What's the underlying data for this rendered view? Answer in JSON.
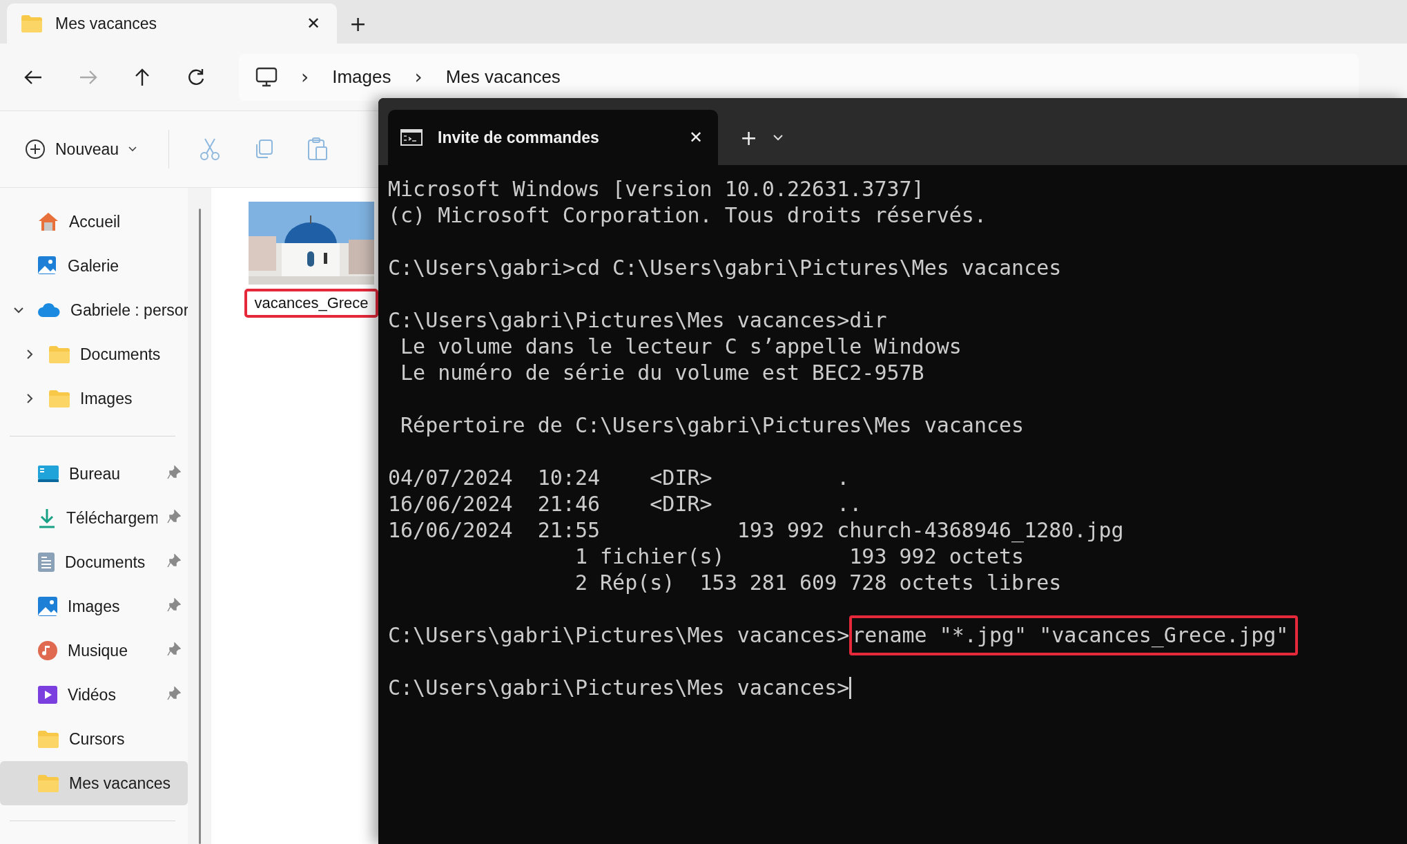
{
  "explorer": {
    "tab": {
      "title": "Mes vacances",
      "close": "✕",
      "new_tab": "+"
    },
    "nav": {
      "forward_disabled": true,
      "breadcrumb": [
        "Images",
        "Mes vacances"
      ],
      "separator": "›"
    },
    "toolbar": {
      "new_label": "Nouveau",
      "clipboard_disabled": true
    },
    "sidebar": {
      "items": [
        {
          "label": "Accueil",
          "selected": false
        },
        {
          "label": "Galerie",
          "selected": false
        },
        {
          "label": "Gabriele : persor",
          "selected": false,
          "expanded": true,
          "children": [
            {
              "label": "Documents",
              "selected": false,
              "expanded": false
            },
            {
              "label": "Images",
              "selected": false,
              "expanded": false
            }
          ]
        }
      ],
      "pinned": [
        {
          "label": "Bureau",
          "selected": false,
          "pinned": true
        },
        {
          "label": "Téléchargem",
          "selected": false,
          "pinned": true
        },
        {
          "label": "Documents",
          "selected": false,
          "pinned": true
        },
        {
          "label": "Images",
          "selected": false,
          "pinned": true
        },
        {
          "label": "Musique",
          "selected": false,
          "pinned": true
        },
        {
          "label": "Vidéos",
          "selected": false,
          "pinned": true
        },
        {
          "label": "Cursors",
          "selected": false,
          "pinned": false
        },
        {
          "label": "Mes vacances",
          "selected": true,
          "pinned": false
        }
      ]
    },
    "files": [
      {
        "kind": "picture",
        "name": "vacances_Grece",
        "highlighted": true
      }
    ]
  },
  "terminal": {
    "tab": {
      "title": "Invite de commandes",
      "close": "✕",
      "new_tab": "+"
    },
    "lines": [
      {
        "kind": "output",
        "text": "Microsoft Windows [version 10.0.22631.3737]"
      },
      {
        "kind": "output",
        "text": "(c) Microsoft Corporation. Tous droits réservés."
      },
      {
        "kind": "gap"
      },
      {
        "kind": "output",
        "text": "C:\\Users\\gabri>cd C:\\Users\\gabri\\Pictures\\Mes vacances"
      },
      {
        "kind": "gap"
      },
      {
        "kind": "output",
        "text": "C:\\Users\\gabri\\Pictures\\Mes vacances>dir"
      },
      {
        "kind": "output",
        "text": " Le volume dans le lecteur C s’appelle Windows"
      },
      {
        "kind": "output",
        "text": " Le numéro de série du volume est BEC2-957B"
      },
      {
        "kind": "gap"
      },
      {
        "kind": "output",
        "text": " Répertoire de C:\\Users\\gabri\\Pictures\\Mes vacances"
      },
      {
        "kind": "gap"
      },
      {
        "kind": "output",
        "text": "04/07/2024  10:24    <DIR>          ."
      },
      {
        "kind": "output",
        "text": "16/06/2024  21:46    <DIR>          .."
      },
      {
        "kind": "output",
        "text": "16/06/2024  21:55           193 992 church-4368946_1280.jpg"
      },
      {
        "kind": "output",
        "text": "               1 fichier(s)          193 992 octets"
      },
      {
        "kind": "output",
        "text": "               2 Rép(s)  153 281 609 728 octets libres"
      },
      {
        "kind": "gap"
      },
      {
        "kind": "command",
        "prompt": "C:\\Users\\gabri\\Pictures\\Mes vacances>",
        "command": "rename \"*.jpg\" \"vacances_Grece.jpg\"",
        "highlighted": true
      },
      {
        "kind": "gap"
      },
      {
        "kind": "cursor",
        "text": "C:\\Users\\gabri\\Pictures\\Mes vacances>"
      }
    ]
  }
}
